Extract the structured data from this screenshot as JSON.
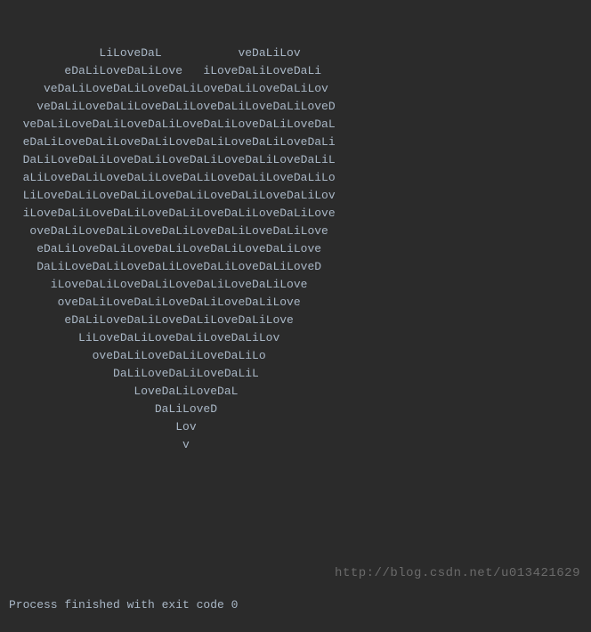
{
  "console": {
    "heart_lines": [
      "             LiLoveDaL           veDaLiLov",
      "        eDaLiLoveDaLiLove   iLoveDaLiLoveDaLi",
      "     veDaLiLoveDaLiLoveDaLiLoveDaLiLoveDaLiLov",
      "    veDaLiLoveDaLiLoveDaLiLoveDaLiLoveDaLiLoveD",
      "  veDaLiLoveDaLiLoveDaLiLoveDaLiLoveDaLiLoveDaL",
      "  eDaLiLoveDaLiLoveDaLiLoveDaLiLoveDaLiLoveDaLi",
      "  DaLiLoveDaLiLoveDaLiLoveDaLiLoveDaLiLoveDaLiL",
      "  aLiLoveDaLiLoveDaLiLoveDaLiLoveDaLiLoveDaLiLo",
      "  LiLoveDaLiLoveDaLiLoveDaLiLoveDaLiLoveDaLiLov",
      "  iLoveDaLiLoveDaLiLoveDaLiLoveDaLiLoveDaLiLove",
      "   oveDaLiLoveDaLiLoveDaLiLoveDaLiLoveDaLiLove",
      "    eDaLiLoveDaLiLoveDaLiLoveDaLiLoveDaLiLove",
      "    DaLiLoveDaLiLoveDaLiLoveDaLiLoveDaLiLoveD",
      "      iLoveDaLiLoveDaLiLoveDaLiLoveDaLiLove",
      "       oveDaLiLoveDaLiLoveDaLiLoveDaLiLove",
      "        eDaLiLoveDaLiLoveDaLiLoveDaLiLove",
      "          LiLoveDaLiLoveDaLiLoveDaLiLov",
      "            oveDaLiLoveDaLiLoveDaLiLo",
      "               DaLiLoveDaLiLoveDaLiL",
      "                  LoveDaLiLoveDaL",
      "                     DaLiLoveD",
      "                        Lov",
      "                         v"
    ],
    "exit_message": "Process finished with exit code 0"
  },
  "watermark": {
    "text": "http://blog.csdn.net/u013421629"
  }
}
